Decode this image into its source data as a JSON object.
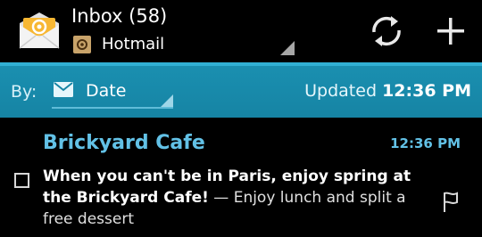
{
  "header": {
    "title": "Inbox (58)",
    "account": "Hotmail",
    "app_icon": "email-app-icon",
    "account_icon": "at-sign-icon",
    "actions": [
      "refresh-icon",
      "add-icon"
    ]
  },
  "sort_bar": {
    "by_label": "By:",
    "sort_value": "Date",
    "updated_label": "Updated",
    "updated_time": "12:36 PM"
  },
  "message": {
    "sender": "Brickyard Cafe",
    "time": "12:36 PM",
    "subject": "When you can't be in Paris, enjoy spring at the Brickyard Cafe!",
    "preview": " — Enjoy lunch and split a free dessert",
    "checked": false,
    "flag_icon": "flag-icon"
  },
  "colors": {
    "accent": "#1a8fb0",
    "separator": "#31b0d4",
    "sender_text": "#62c1e6",
    "background": "#000000"
  }
}
